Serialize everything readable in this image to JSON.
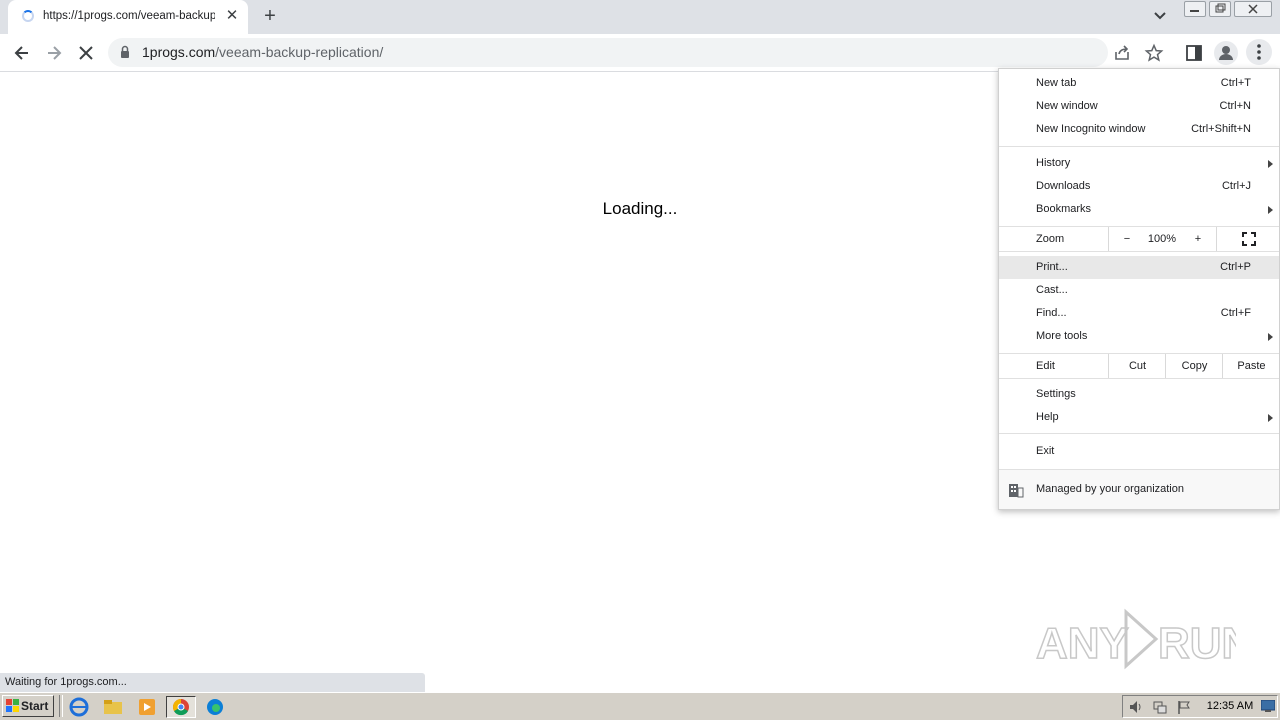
{
  "browser": {
    "tab_title": "https://1progs.com/veeam-backup-r",
    "url_host": "1progs.com",
    "url_path": "/veeam-backup-replication/"
  },
  "page": {
    "loading_text": "Loading...",
    "status_text": "Waiting for 1progs.com..."
  },
  "menu": {
    "new_tab": {
      "label": "New tab",
      "shortcut": "Ctrl+T"
    },
    "new_window": {
      "label": "New window",
      "shortcut": "Ctrl+N"
    },
    "new_incognito": {
      "label": "New Incognito window",
      "shortcut": "Ctrl+Shift+N"
    },
    "history": {
      "label": "History"
    },
    "downloads": {
      "label": "Downloads",
      "shortcut": "Ctrl+J"
    },
    "bookmarks": {
      "label": "Bookmarks"
    },
    "zoom": {
      "label": "Zoom",
      "minus": "−",
      "value": "100%",
      "plus": "+"
    },
    "print": {
      "label": "Print...",
      "shortcut": "Ctrl+P"
    },
    "cast": {
      "label": "Cast..."
    },
    "find": {
      "label": "Find...",
      "shortcut": "Ctrl+F"
    },
    "more_tools": {
      "label": "More tools"
    },
    "edit": {
      "label": "Edit",
      "cut": "Cut",
      "copy": "Copy",
      "paste": "Paste"
    },
    "settings": {
      "label": "Settings"
    },
    "help": {
      "label": "Help"
    },
    "exit": {
      "label": "Exit"
    },
    "managed": {
      "label": "Managed by your organization"
    }
  },
  "taskbar": {
    "start_label": "Start",
    "clock": "12:35 AM"
  },
  "watermark": {
    "text": "ANY RUN"
  }
}
